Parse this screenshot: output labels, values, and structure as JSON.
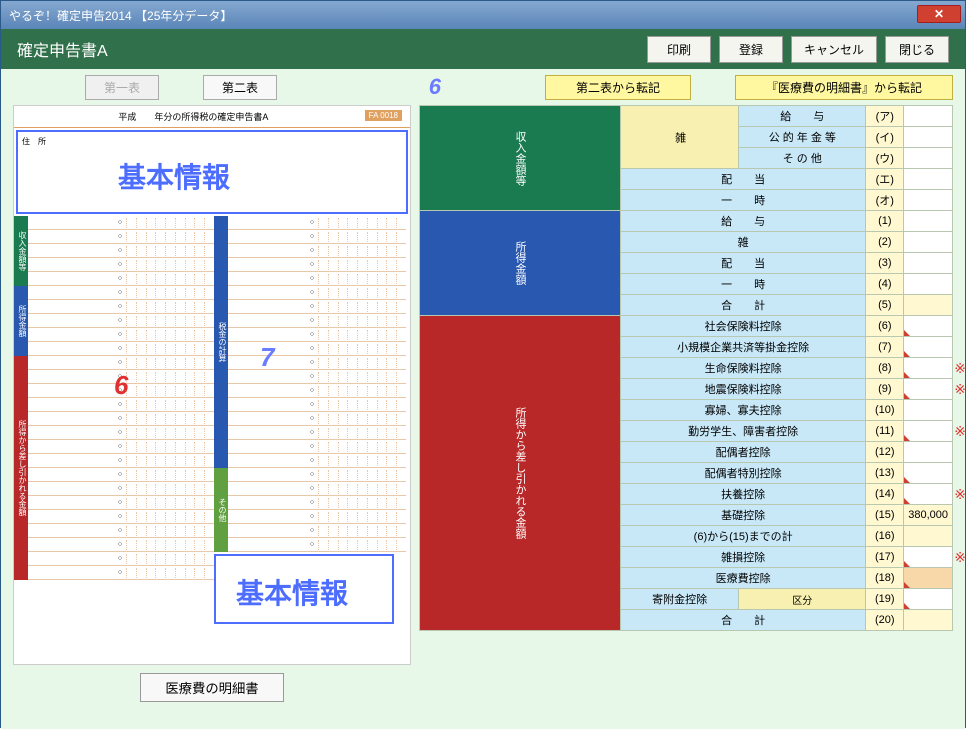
{
  "window": {
    "title": "やるぞ！確定申告2014 【25年分データ】"
  },
  "header": {
    "title": "確定申告書A",
    "buttons": {
      "print": "印刷",
      "save": "登録",
      "cancel": "キャンセル",
      "close": "閉じる"
    }
  },
  "tabs": {
    "first": "第一表",
    "second": "第二表"
  },
  "transfer": {
    "from_second": "第二表から転記",
    "from_medical": "『医療費の明細書』から転記"
  },
  "annotation": {
    "num6": "6",
    "num7": "7",
    "basic_info": "基本情報"
  },
  "preview": {
    "title": "平成　　年分の所得税の確定申告書A",
    "code": "FA 0018",
    "addr": "住　所",
    "medical_btn": "医療費の明細書"
  },
  "rows_income": [
    {
      "label": "給　　与",
      "idx": "(ア)"
    },
    {
      "label": "公 的 年 金 等",
      "idx": "(イ)"
    },
    {
      "label": "そ の 他",
      "idx": "(ウ)"
    },
    {
      "label": "配　　当",
      "idx": "(エ)"
    },
    {
      "label": "一　　時",
      "idx": "(オ)"
    }
  ],
  "misc_label": "雑",
  "rows_amount": [
    {
      "label": "給　　与",
      "idx": "(1)"
    },
    {
      "label": "雑",
      "idx": "(2)"
    },
    {
      "label": "配　　当",
      "idx": "(3)"
    },
    {
      "label": "一　　時",
      "idx": "(4)"
    },
    {
      "label": "合　　計",
      "idx": "(5)"
    }
  ],
  "rows_deduct": [
    {
      "label": "社会保険料控除",
      "idx": "(6)",
      "tri": true
    },
    {
      "label": "小規模企業共済等掛金控除",
      "idx": "(7)",
      "tri": true
    },
    {
      "label": "生命保険料控除",
      "idx": "(8)",
      "tri": true,
      "ast": true
    },
    {
      "label": "地震保険料控除",
      "idx": "(9)",
      "tri": true,
      "ast": true
    },
    {
      "label": "寡婦、寡夫控除",
      "idx": "(10)"
    },
    {
      "label": "勤労学生、障害者控除",
      "idx": "(11)",
      "tri": true,
      "ast": true
    },
    {
      "label": "配偶者控除",
      "idx": "(12)"
    },
    {
      "label": "配偶者特別控除",
      "idx": "(13)",
      "tri": true
    },
    {
      "label": "扶養控除",
      "idx": "(14)",
      "tri": true,
      "ast": true
    },
    {
      "label": "基礎控除",
      "idx": "(15)",
      "val": "380,000",
      "cls": "val-yellow"
    },
    {
      "label": "(6)から(15)までの計",
      "idx": "(16)",
      "cls": "val-yellow"
    },
    {
      "label": "雑損控除",
      "idx": "(17)",
      "tri": true,
      "ast": true
    },
    {
      "label": "医療費控除",
      "idx": "(18)",
      "tri": true,
      "cls": "val-orange"
    },
    {
      "label": "寄附金控除",
      "idx": "(19)",
      "tri": true,
      "kubun": true
    },
    {
      "label": "合　　計",
      "idx": "(20)",
      "cls": "val-yellow"
    }
  ],
  "kubun_label": "区分",
  "side": {
    "income": "収入金額等",
    "amount": "所得金額",
    "deduct": "所得から差し引かれる金額"
  }
}
